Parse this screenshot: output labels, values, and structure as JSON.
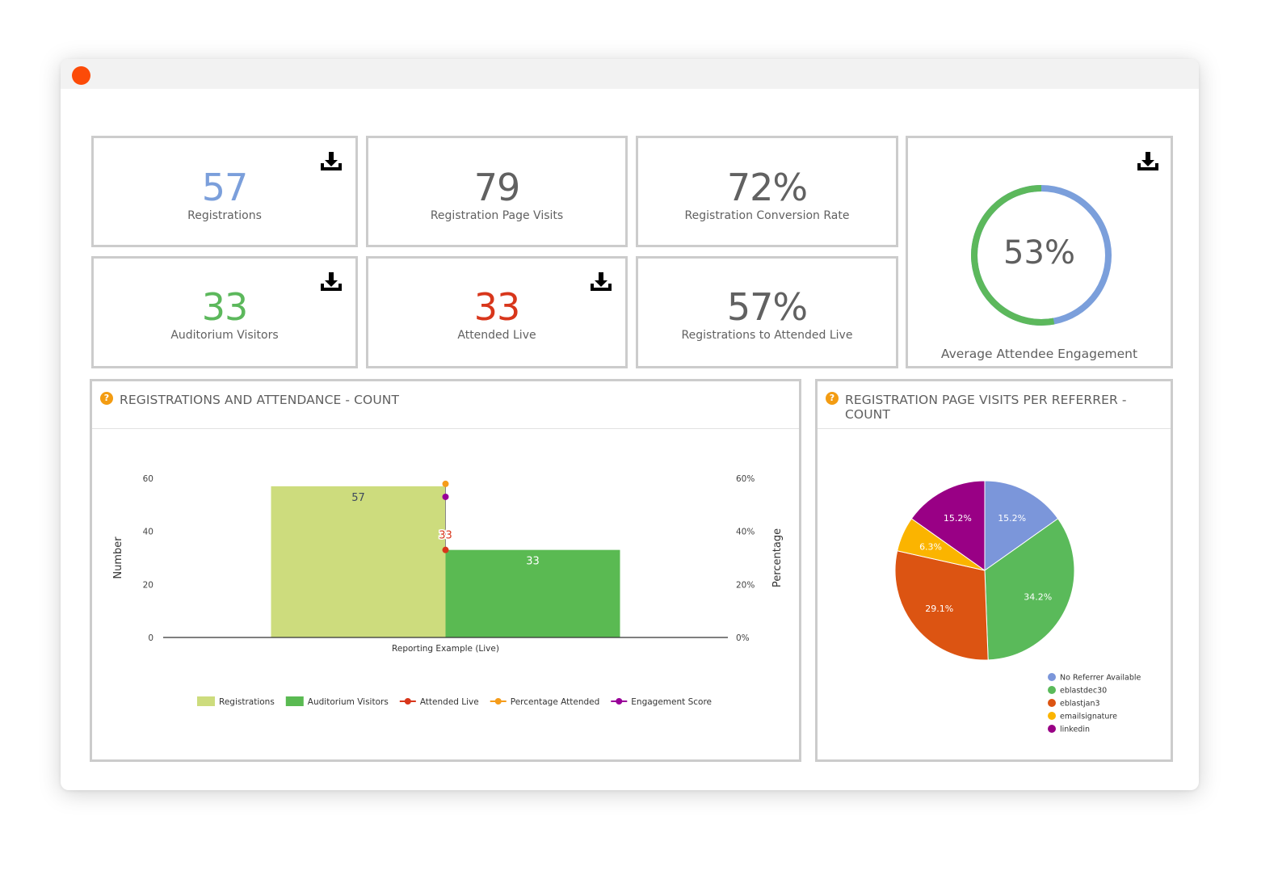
{
  "window": {
    "close_color": "#fc4b08"
  },
  "stats": {
    "registrations": {
      "value": "57",
      "label": "Registrations",
      "color": "#7b9fdb",
      "download": "download-icon"
    },
    "page_visits": {
      "value": "79",
      "label": "Registration Page Visits",
      "color": "#616161"
    },
    "conversion_rate": {
      "value": "72%",
      "label": "Registration Conversion Rate",
      "color": "#616161"
    },
    "auditorium_visitors": {
      "value": "33",
      "label": "Auditorium Visitors",
      "color": "#5cb85c",
      "download": "download-icon"
    },
    "attended_live": {
      "value": "33",
      "label": "Attended Live",
      "color": "#d8361b",
      "download": "download-icon"
    },
    "registrations_to_attended": {
      "value": "57%",
      "label": "Registrations to Attended Live",
      "color": "#616161"
    }
  },
  "engagement": {
    "value": "53%",
    "label": "Average Attendee Engagement",
    "fraction": 0.53,
    "colors": {
      "engaged": "#5cb85c",
      "remaining": "#7b9fdb"
    }
  },
  "panels": {
    "registrations_attendance": {
      "title": "REGISTRATIONS AND ATTENDANCE - COUNT",
      "help_icon": "?"
    },
    "referrer": {
      "title": "REGISTRATION PAGE VISITS PER REFERRER - COUNT",
      "help_icon": "?"
    }
  },
  "chart_data": [
    {
      "type": "bar",
      "title": "REGISTRATIONS AND ATTENDANCE - COUNT",
      "categories": [
        "Reporting Example (Live)"
      ],
      "xlabel": "",
      "ylabel": "Number",
      "y2label": "Percentage",
      "ylim": [
        0,
        60
      ],
      "y2lim": [
        0,
        0.6
      ],
      "yticks": [
        "0",
        "20",
        "40",
        "60"
      ],
      "y2ticks": [
        "0%",
        "20%",
        "40%",
        "60%"
      ],
      "bars": [
        {
          "name": "Registrations",
          "values": [
            57
          ],
          "color": "#cddc7d",
          "label": "57",
          "label_color": "#3e4a5c"
        },
        {
          "name": "Auditorium Visitors",
          "values": [
            33
          ],
          "color": "#5aba52",
          "label": "33",
          "label_color": "#ffffff"
        }
      ],
      "points": [
        {
          "name": "Attended Live",
          "axis": "left",
          "values": [
            33
          ],
          "color": "#d8361b",
          "label": "33"
        },
        {
          "name": "Percentage Attended",
          "axis": "right",
          "values": [
            0.579
          ],
          "color": "#f59c1a"
        },
        {
          "name": "Engagement Score",
          "axis": "right",
          "values": [
            0.53
          ],
          "color": "#990099"
        }
      ],
      "legend": [
        {
          "label": "Registrations",
          "kind": "box",
          "color": "#cddc7d"
        },
        {
          "label": "Auditorium Visitors",
          "kind": "box",
          "color": "#5aba52"
        },
        {
          "label": "Attended Live",
          "kind": "line",
          "color": "#d8361b"
        },
        {
          "label": "Percentage Attended",
          "kind": "line",
          "color": "#f59c1a"
        },
        {
          "label": "Engagement Score",
          "kind": "line",
          "color": "#990099"
        }
      ],
      "legend_position": "bottom",
      "grid": false
    },
    {
      "type": "pie",
      "title": "REGISTRATION PAGE VISITS PER REFERRER - COUNT",
      "slices": [
        {
          "label": "No Referrer Available",
          "value": 15.2,
          "text": "15.2%",
          "color": "#7b96da"
        },
        {
          "label": "eblastdec30",
          "value": 34.2,
          "text": "34.2%",
          "color": "#5aba5a"
        },
        {
          "label": "eblastjan3",
          "value": 29.1,
          "text": "29.1%",
          "color": "#dc5412"
        },
        {
          "label": "emailsignature",
          "value": 6.3,
          "text": "6.3%",
          "color": "#fbb400"
        },
        {
          "label": "linkedin",
          "value": 15.2,
          "text": "15.2%",
          "color": "#990085"
        }
      ],
      "legend_position": "bottom-right"
    }
  ]
}
